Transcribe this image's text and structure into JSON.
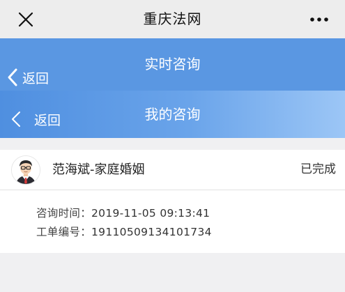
{
  "window": {
    "title": "重庆法网"
  },
  "nav_primary": {
    "back_label": "返回",
    "title": "实时咨询"
  },
  "nav_secondary": {
    "back_label": "返回",
    "title": "我的咨询"
  },
  "consultation": {
    "lawyer_topic": "范海斌-家庭婚姻",
    "status": "已完成",
    "time_label": "咨询时间：",
    "time_value": "2019-11-05 09:13:41",
    "order_label": "工单编号：",
    "order_value": "19110509134101734"
  },
  "icons": {
    "close": "close-icon",
    "more": "more-icon",
    "back": "chevron-left-icon",
    "avatar": "lawyer-avatar-icon"
  },
  "colors": {
    "primary_blue": "#5a97e2",
    "gradient_end": "#9cc6f6",
    "background": "#f0f0f2"
  }
}
